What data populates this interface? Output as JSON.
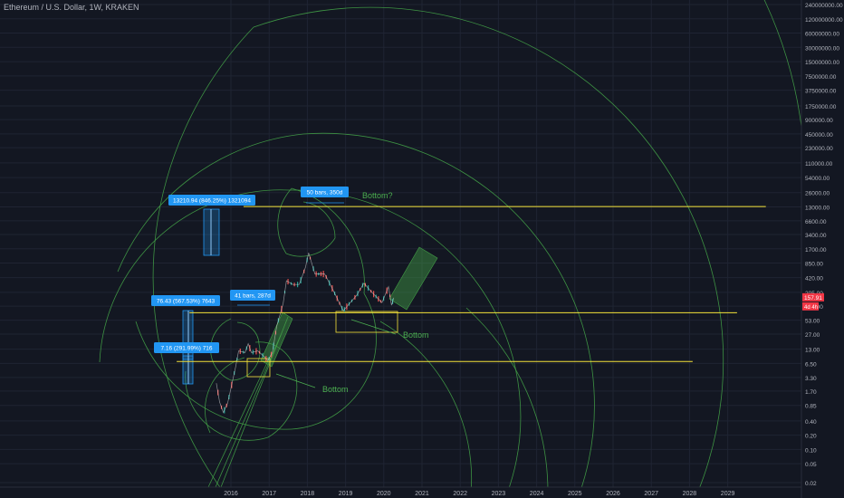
{
  "header": {
    "title": "Ethereum / U.S. Dollar, 1W, KRAKEN"
  },
  "chart_data": {
    "type": "line",
    "title": "Ethereum / U.S. Dollar, 1W, KRAKEN",
    "y_scale": "log",
    "y_ticks": [
      "240000000.00",
      "120000000.00",
      "60000000.00",
      "30000000.00",
      "15000000.00",
      "7500000.00",
      "3750000.00",
      "1750000.00",
      "900000.00",
      "450000.00",
      "230000.00",
      "110000.00",
      "54000.00",
      "26000.00",
      "13000.00",
      "6600.00",
      "3400.00",
      "1700.00",
      "850.00",
      "420.00",
      "205.00",
      "105.00",
      "53.00",
      "27.00",
      "13.00",
      "6.50",
      "3.30",
      "1.70",
      "0.85",
      "0.40",
      "0.20",
      "0.10",
      "0.05",
      "0.02"
    ],
    "x_ticks": [
      "2016",
      "2017",
      "2018",
      "2019",
      "2020",
      "2021",
      "2022",
      "2023",
      "2024",
      "2025",
      "2026",
      "2027",
      "2028",
      "2029"
    ],
    "current_price": "157.91",
    "countdown": "4d 4h",
    "price_series": [
      [
        "2015-08-15",
        2.5
      ],
      [
        "2015-09-15",
        1.0
      ],
      [
        "2015-10-20",
        0.6
      ],
      [
        "2015-12-01",
        0.95
      ],
      [
        "2016-02-15",
        5.5
      ],
      [
        "2016-03-15",
        12
      ],
      [
        "2016-05-15",
        11
      ],
      [
        "2016-06-15",
        17
      ],
      [
        "2016-07-15",
        11
      ],
      [
        "2016-09-15",
        12
      ],
      [
        "2016-11-15",
        9
      ],
      [
        "2016-12-20",
        7.5
      ],
      [
        "2017-02-01",
        11
      ],
      [
        "2017-03-15",
        40
      ],
      [
        "2017-05-15",
        120
      ],
      [
        "2017-06-15",
        360
      ],
      [
        "2017-08-15",
        300
      ],
      [
        "2017-10-15",
        300
      ],
      [
        "2017-12-15",
        700
      ],
      [
        "2018-01-13",
        1400
      ],
      [
        "2018-03-15",
        500
      ],
      [
        "2018-06-15",
        500
      ],
      [
        "2018-08-15",
        280
      ],
      [
        "2018-12-10",
        84
      ],
      [
        "2019-02-15",
        125
      ],
      [
        "2019-04-15",
        175
      ],
      [
        "2019-06-25",
        320
      ],
      [
        "2019-09-15",
        200
      ],
      [
        "2019-12-15",
        125
      ],
      [
        "2020-02-15",
        270
      ],
      [
        "2020-03-15",
        110
      ],
      [
        "2020-04-05",
        158
      ]
    ],
    "horizontal_levels": [
      {
        "price": 13210.94,
        "from": "2016-05-01",
        "to": "2029-12-31"
      },
      {
        "price": 76.43,
        "from": "2014-12-01",
        "to": "2029-03-31"
      },
      {
        "price": 7.16,
        "from": "2014-08-01",
        "to": "2028-01-31"
      }
    ],
    "annotations": [
      {
        "text": "13210.94 (846.25%) 1321094",
        "type": "price-range-label"
      },
      {
        "text": "76.43 (567.53%) 7643",
        "type": "price-range-label"
      },
      {
        "text": "7.16 (291.99%) 716",
        "type": "price-range-label"
      },
      {
        "text": "50 bars, 350d",
        "type": "date-range-label"
      },
      {
        "text": "41 bars, 287d",
        "type": "date-range-label"
      },
      {
        "text": "Bottom?",
        "type": "note"
      },
      {
        "text": "Bottom",
        "type": "note"
      },
      {
        "text": "Bottom",
        "type": "note"
      }
    ]
  },
  "colors": {
    "background": "#131722",
    "grid": "#1f2433",
    "axis_text": "#b2b5be",
    "level": "#f5e33a",
    "spiral": "#43a047",
    "up": "#26a69a",
    "down": "#ef5350",
    "label_bg": "#2196f3",
    "note": "#4caf50",
    "price_badge": "#f23645"
  }
}
